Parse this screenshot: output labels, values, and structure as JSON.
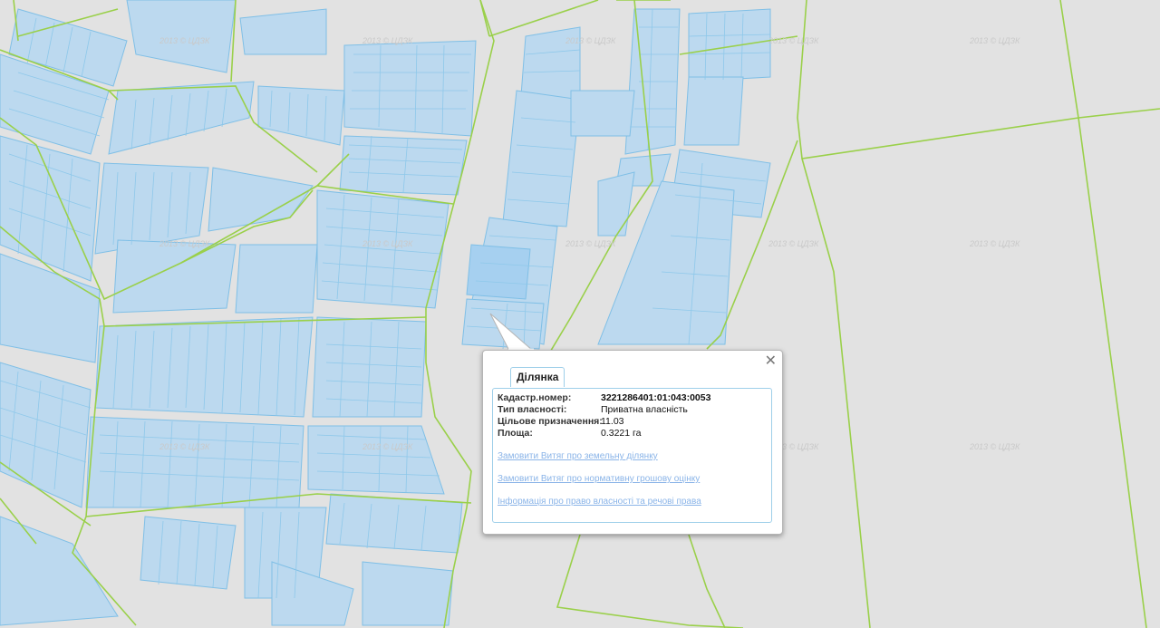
{
  "map": {
    "watermark_text": "2013 © ЦДЗК",
    "colors": {
      "background": "#e2e2e2",
      "parcel_fill": "#b9d8f0",
      "parcel_stroke": "#7fbfe6",
      "boundary": "#9ad04a"
    }
  },
  "popup": {
    "tab_label": "Ділянка",
    "close_icon": "close-icon",
    "fields": [
      {
        "label": "Кадастр.номер:",
        "value": "3221286401:01:043:0053"
      },
      {
        "label": "Тип власності:",
        "value": "Приватна власність"
      },
      {
        "label": "Цільове призначення:",
        "value": "11.03"
      },
      {
        "label": "Площа:",
        "value": "0.3221 га"
      }
    ],
    "links": [
      "Замовити Витяг про земельну ділянку",
      "Замовити Витяг про нормативну грошову оцінку",
      "Інформація про право власності та речові права"
    ]
  }
}
